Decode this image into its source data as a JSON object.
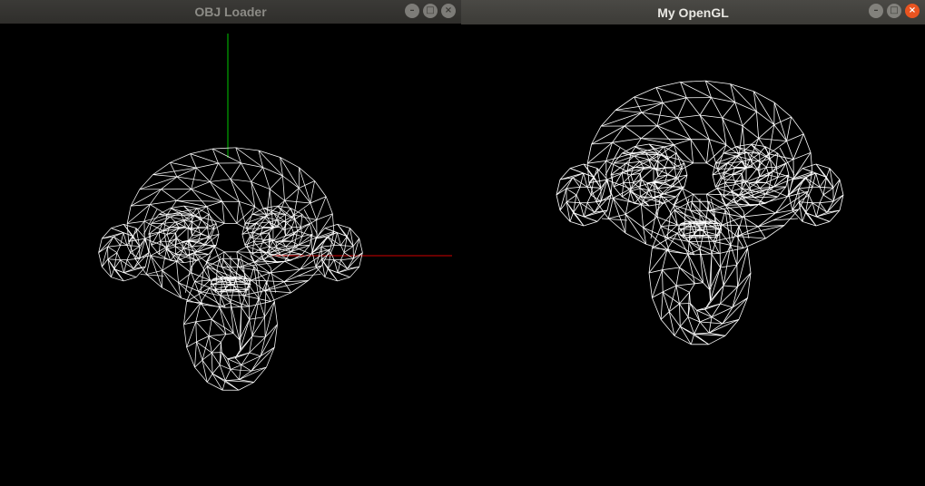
{
  "windows": [
    {
      "title": "OBJ Loader",
      "focused": false
    },
    {
      "title": "My OpenGL",
      "focused": true
    }
  ],
  "controls": {
    "minimize_icon": "minimize-icon",
    "maximize_icon": "maximize-icon",
    "close_icon": "close-icon",
    "minimize_glyph": "–",
    "maximize_glyph": "□",
    "close_glyph": "×"
  },
  "scene": {
    "model": "wireframe monkey head (Suzanne)",
    "wire_color": "#ffffff",
    "background": "#000000",
    "axis_y_color": "#00c800",
    "axis_x_color": "#d00000",
    "left_shows_axes": true,
    "right_shows_axes": false
  }
}
